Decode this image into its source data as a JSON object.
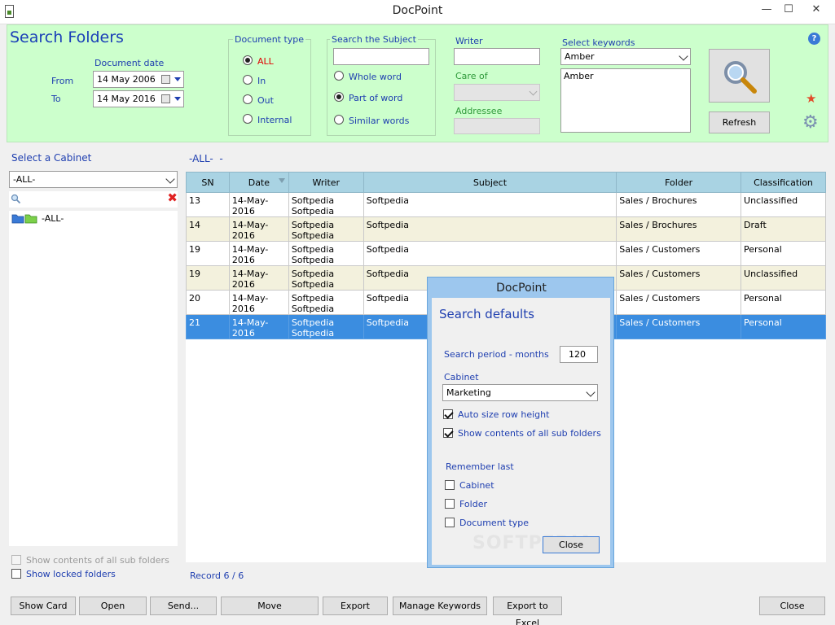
{
  "window": {
    "title": "DocPoint",
    "minimize": "—",
    "maximize": "☐",
    "close": "✕"
  },
  "search": {
    "heading": "Search Folders",
    "date_label": "Document date",
    "from_label": "From",
    "from_value": "14 May 2006",
    "to_label": "To",
    "to_value": "14 May 2016",
    "doctype": {
      "label": "Document type",
      "options": [
        "ALL",
        "In",
        "Out",
        "Internal"
      ],
      "selected": "ALL"
    },
    "subject": {
      "label": "Search the Subject",
      "value": "",
      "options": [
        "Whole word",
        "Part of word",
        "Similar words"
      ],
      "selected": "Part of word"
    },
    "writer_label": "Writer",
    "writer_value": "",
    "care_label": "Care of",
    "care_value": "",
    "addressee_label": "Addressee",
    "addressee_value": "",
    "keywords_label": "Select keywords",
    "keywords_selected": "Amber",
    "keywords_list": [
      "Amber"
    ],
    "refresh_label": "Refresh"
  },
  "left": {
    "cabinet_label": "Select a Cabinet",
    "cabinet_value": "-ALL-",
    "filter_value": "",
    "tree_root": "-ALL-",
    "show_sub_label": "Show contents of all sub folders",
    "show_locked_label": "Show locked folders"
  },
  "grid": {
    "path": "-ALL-  -",
    "columns": [
      "SN",
      "Date",
      "Writer",
      "Subject",
      "Folder",
      "Classification"
    ],
    "rows": [
      {
        "sn": "13",
        "date": "14-May-2016",
        "writer1": "Softpedia",
        "writer2": "Softpedia",
        "subject": "Softpedia",
        "folder": "Sales / Brochures",
        "classification": "Unclassified"
      },
      {
        "sn": "14",
        "date": "14-May-2016",
        "writer1": "Softpedia",
        "writer2": "Softpedia",
        "subject": "Softpedia",
        "folder": "Sales / Brochures",
        "classification": "Draft"
      },
      {
        "sn": "19",
        "date": "14-May-2016",
        "writer1": "Softpedia",
        "writer2": "Softpedia",
        "subject": "Softpedia",
        "folder": "Sales / Customers",
        "classification": "Personal"
      },
      {
        "sn": "19",
        "date": "14-May-2016",
        "writer1": "Softpedia",
        "writer2": "Softpedia",
        "subject": "Softpedia",
        "folder": "Sales / Customers",
        "classification": "Unclassified"
      },
      {
        "sn": "20",
        "date": "14-May-2016",
        "writer1": "Softpedia",
        "writer2": "Softpedia",
        "subject": "Softpedia",
        "folder": "Sales / Customers",
        "classification": "Personal"
      },
      {
        "sn": "21",
        "date": "14-May-2016",
        "writer1": "Softpedia",
        "writer2": "Softpedia",
        "subject": "Softpedia",
        "folder": "Sales / Customers",
        "classification": "Personal"
      }
    ],
    "selected_row": 5,
    "record_text": "Record 6 / 6"
  },
  "dialog": {
    "title": "DocPoint",
    "heading": "Search defaults",
    "period_label": "Search period - months",
    "period_value": "120",
    "cabinet_label": "Cabinet",
    "cabinet_value": "Marketing",
    "auto_size_label": "Auto size row height",
    "show_sub_label": "Show contents of all sub folders",
    "remember_label": "Remember last",
    "remember_cabinet": "Cabinet",
    "remember_folder": "Folder",
    "remember_doctype": "Document type",
    "close_label": "Close"
  },
  "toolbar": {
    "show_card": "Show Card",
    "open": "Open",
    "send": "Send...",
    "move": "Move",
    "export": "Export",
    "manage_keywords": "Manage Keywords",
    "export_excel": "Export to Excel",
    "close": "Close"
  },
  "watermark": "SOFTPEDIA",
  "colors": {
    "search_panel": "#ccffcc",
    "label_blue": "#1f3fb0",
    "label_green": "#2f9a3a",
    "header": "#a9d3e3",
    "selected_row": "#3b8de0",
    "alt_row": "#f3f1dd",
    "dialog_frame": "#9dc7ee"
  }
}
